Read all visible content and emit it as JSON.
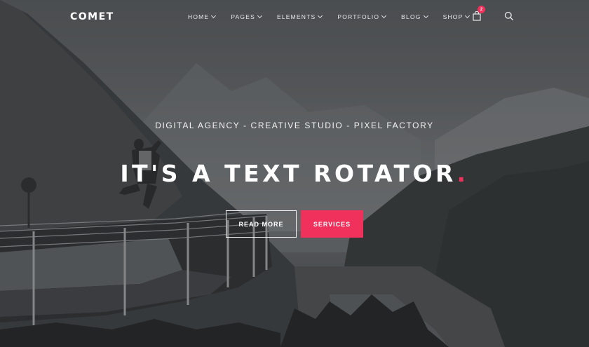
{
  "brand": {
    "logo_text": "COMET"
  },
  "nav": {
    "items": [
      {
        "label": "HOME"
      },
      {
        "label": "PAGES"
      },
      {
        "label": "ELEMENTS"
      },
      {
        "label": "PORTFOLIO"
      },
      {
        "label": "BLOG"
      },
      {
        "label": "SHOP"
      }
    ],
    "cart_count": "2"
  },
  "hero": {
    "subtitle": "DIGITAL AGENCY - CREATIVE STUDIO - PIXEL FACTORY",
    "headline": "IT'S A TEXT ROTATOR",
    "headline_dot": ".",
    "primary_button": "READ MORE",
    "secondary_button": "SERVICES"
  },
  "colors": {
    "accent": "#f0315b",
    "overlay": "#3b3d40"
  }
}
